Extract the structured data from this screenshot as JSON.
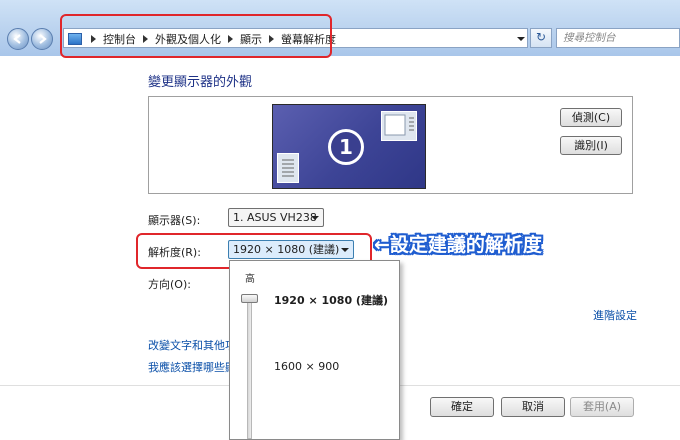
{
  "breadcrumbs": [
    "控制台",
    "外觀及個人化",
    "顯示",
    "螢幕解析度"
  ],
  "search": {
    "placeholder": "搜尋控制台"
  },
  "refresh_glyph": "↻",
  "page_title": "變更顯示器的外觀",
  "monitor": {
    "number": "1"
  },
  "buttons": {
    "detect": "偵測(C)",
    "identify": "識別(I)",
    "ok": "確定",
    "cancel": "取消",
    "apply": "套用(A)"
  },
  "fields": {
    "display_label": "顯示器(S):",
    "display_value": "1. ASUS VH238",
    "resolution_label": "解析度(R):",
    "resolution_value": "1920 × 1080 (建議)",
    "orientation_label": "方向(O):"
  },
  "links": {
    "advanced": "進階設定",
    "text_size": "改變文字和其他項",
    "which_settings": "我應該選擇哪些顯"
  },
  "dropdown": {
    "high_label": "高",
    "options": [
      "1920 × 1080 (建議)",
      "1600 × 900"
    ],
    "slider_level": 1.0
  },
  "annotation": "←設定建議的解析度",
  "colors": {
    "accent": "#1e3287",
    "highlight_border": "#e0262b",
    "annotation": "#1f5dd0"
  }
}
